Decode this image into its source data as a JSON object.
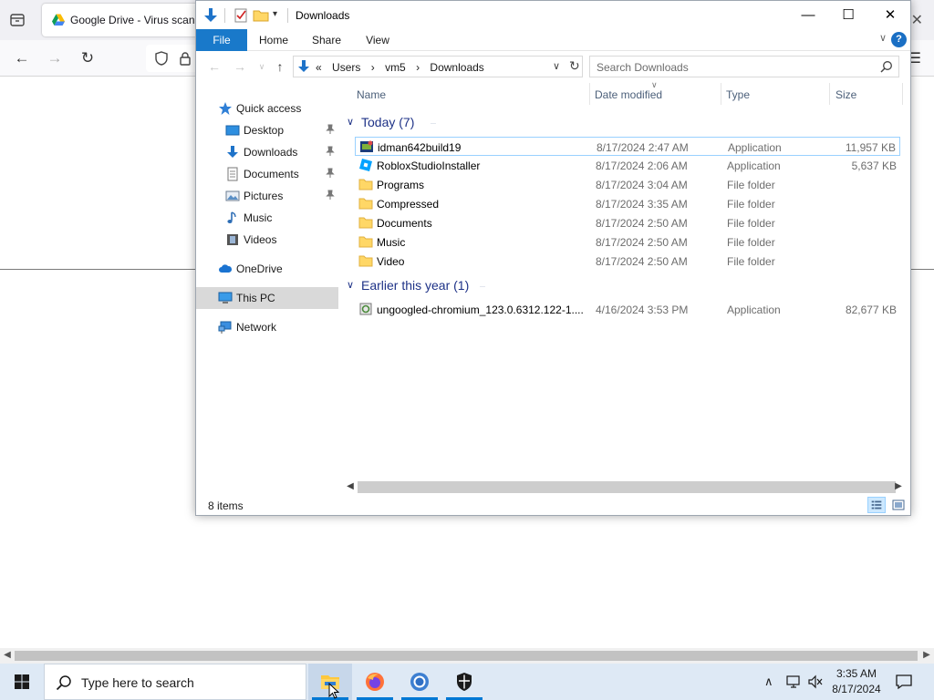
{
  "browser": {
    "tab_title": "Google Drive - Virus scan",
    "close_glyph": "✕"
  },
  "explorer": {
    "title": "Downloads",
    "ribbon_tabs": [
      "File",
      "Home",
      "Share",
      "View"
    ],
    "help_glyph": "?",
    "address": {
      "crumbs": [
        "«",
        "Users",
        "›",
        "vm5",
        "›",
        "Downloads"
      ]
    },
    "search_placeholder": "Search Downloads",
    "nav_pane": [
      {
        "label": "Quick access",
        "icon": "star-icon",
        "pinned": false,
        "selected": false
      },
      {
        "label": "Desktop",
        "icon": "desktop-icon",
        "pinned": true,
        "selected": false
      },
      {
        "label": "Downloads",
        "icon": "download-icon",
        "pinned": true,
        "selected": false
      },
      {
        "label": "Documents",
        "icon": "document-icon",
        "pinned": true,
        "selected": false
      },
      {
        "label": "Pictures",
        "icon": "pictures-icon",
        "pinned": true,
        "selected": false
      },
      {
        "label": "Music",
        "icon": "music-icon",
        "pinned": false,
        "selected": false
      },
      {
        "label": "Videos",
        "icon": "videos-icon",
        "pinned": false,
        "selected": false
      },
      {
        "label": "OneDrive",
        "icon": "cloud-icon",
        "pinned": false,
        "selected": false
      },
      {
        "label": "This PC",
        "icon": "computer-icon",
        "pinned": false,
        "selected": true
      },
      {
        "label": "Network",
        "icon": "network-icon",
        "pinned": false,
        "selected": false
      }
    ],
    "columns": [
      "Name",
      "Date modified",
      "Type",
      "Size"
    ],
    "groups": [
      {
        "label": "Today (7)",
        "files": [
          {
            "name": "idman642build19",
            "date": "8/17/2024 2:47 AM",
            "type": "Application",
            "size": "11,957 KB",
            "icon": "idm-app-icon",
            "selected": true
          },
          {
            "name": "RobloxStudioInstaller",
            "date": "8/17/2024 2:06 AM",
            "type": "Application",
            "size": "5,637 KB",
            "icon": "roblox-app-icon",
            "selected": false
          },
          {
            "name": "Programs",
            "date": "8/17/2024 3:04 AM",
            "type": "File folder",
            "size": "",
            "icon": "folder-icon",
            "selected": false
          },
          {
            "name": "Compressed",
            "date": "8/17/2024 3:35 AM",
            "type": "File folder",
            "size": "",
            "icon": "folder-icon",
            "selected": false
          },
          {
            "name": "Documents",
            "date": "8/17/2024 2:50 AM",
            "type": "File folder",
            "size": "",
            "icon": "folder-icon",
            "selected": false
          },
          {
            "name": "Music",
            "date": "8/17/2024 2:50 AM",
            "type": "File folder",
            "size": "",
            "icon": "folder-icon",
            "selected": false
          },
          {
            "name": "Video",
            "date": "8/17/2024 2:50 AM",
            "type": "File folder",
            "size": "",
            "icon": "folder-icon",
            "selected": false
          }
        ]
      },
      {
        "label": "Earlier this year (1)",
        "files": [
          {
            "name": "ungoogled-chromium_123.0.6312.122-1....",
            "date": "4/16/2024 3:53 PM",
            "type": "Application",
            "size": "82,677 KB",
            "icon": "installer-app-icon",
            "selected": false
          }
        ]
      }
    ],
    "status_count": "8 items"
  },
  "taskbar": {
    "search_placeholder": "Type here to search",
    "apps": [
      "file-explorer",
      "firefox",
      "chrome",
      "security"
    ],
    "clock_time": "3:35 AM",
    "clock_date": "8/17/2024"
  },
  "colors": {
    "file_tab": "#1979ca",
    "accent": "#0078d4",
    "group_header": "#1e3287",
    "taskbar": "#dee9f5"
  }
}
